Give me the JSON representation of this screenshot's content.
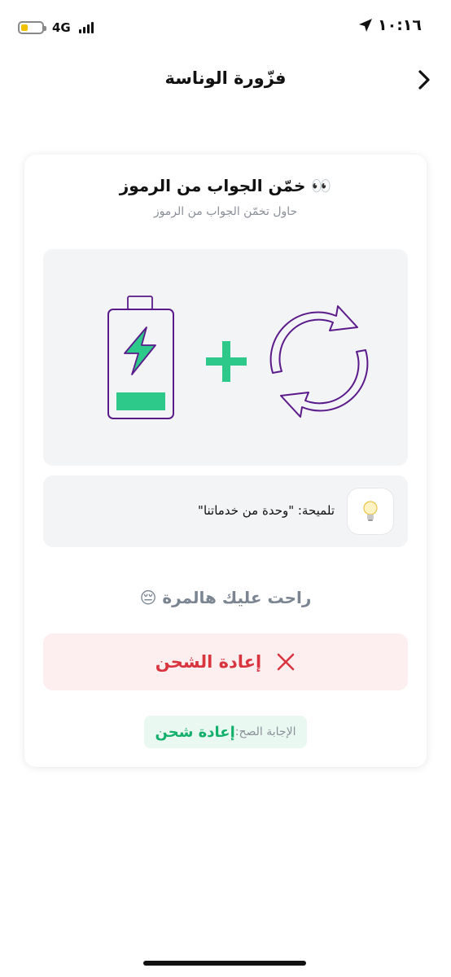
{
  "status_bar": {
    "time": "١٠:١٦",
    "network": "4G",
    "battery_level": 0.35,
    "battery_color": "#f2c200"
  },
  "header": {
    "title": "فزّورة الوناسة",
    "back_icon": "chevron-right-icon"
  },
  "card": {
    "title": "خمّن الجواب من الرموز 👀",
    "subtitle": "حاول تخمّن الجواب من الرموز",
    "symbols": [
      "battery-charging-icon",
      "plus-icon",
      "refresh-arrows-icon"
    ],
    "colors": {
      "accent_green": "#2dc98b",
      "outline_purple": "#5b1a8a"
    }
  },
  "hint": {
    "icon": "lightbulb-icon",
    "text": "تلميحة: \"وحدة من خدماتنا\""
  },
  "result": {
    "message": "راحت عليك هالمرة 😔"
  },
  "answer_wrong": {
    "label": "إعادة الشحن",
    "icon": "close-x-icon",
    "color": "#d8353f"
  },
  "correct_answer": {
    "label": "الإجابة الصح:",
    "value": "إعادة شحن"
  }
}
